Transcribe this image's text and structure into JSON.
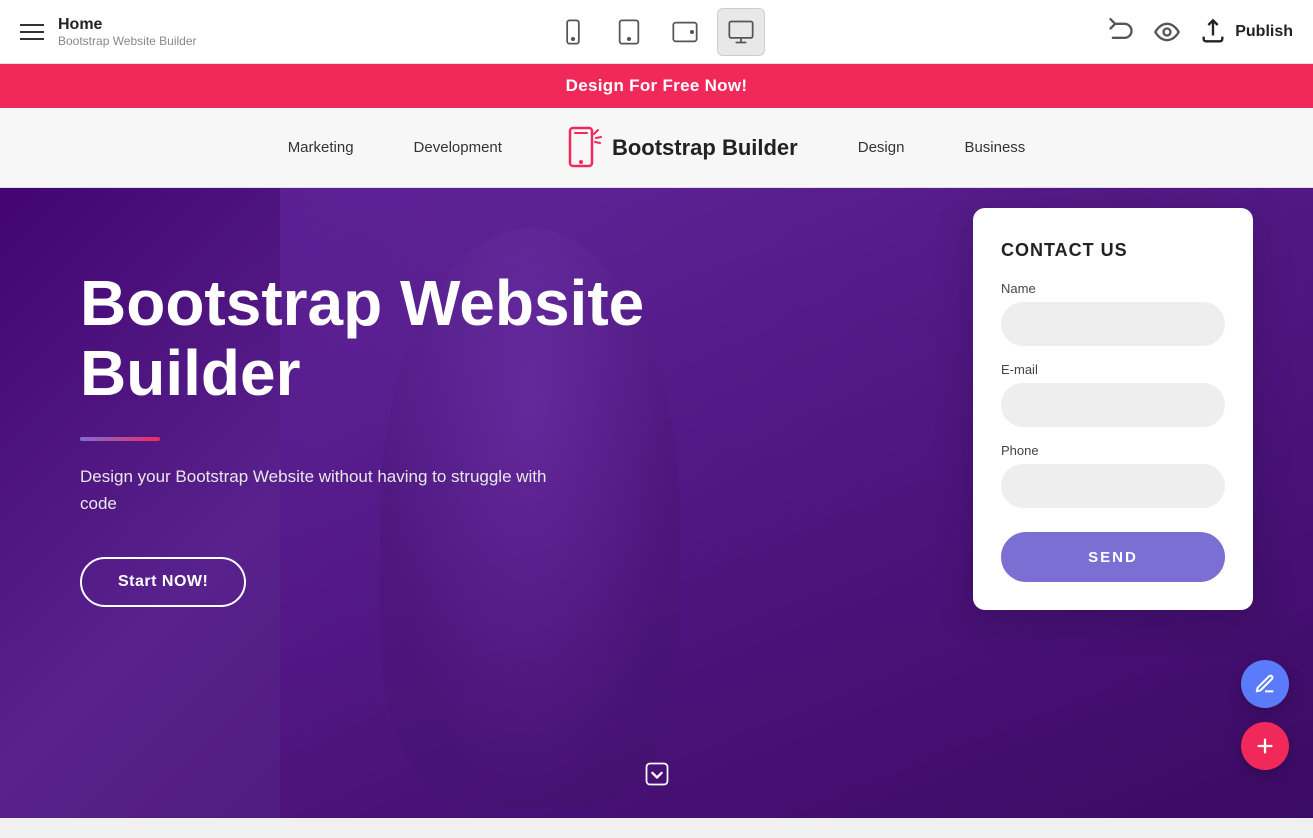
{
  "toolbar": {
    "home_label": "Home",
    "subtitle": "Bootstrap Website Builder",
    "publish_label": "Publish"
  },
  "promo": {
    "text": "Design For Free Now!"
  },
  "site_nav": {
    "links": [
      "Marketing",
      "Development",
      "Design",
      "Business"
    ],
    "brand_name": "Bootstrap Builder"
  },
  "hero": {
    "title": "Bootstrap Website Builder",
    "subtitle": "Design your Bootstrap Website without having to struggle with code",
    "cta_label": "Start NOW!"
  },
  "contact": {
    "title": "CONTACT US",
    "name_label": "Name",
    "email_label": "E-mail",
    "phone_label": "Phone",
    "send_label": "SEND",
    "name_placeholder": "",
    "email_placeholder": "",
    "phone_placeholder": ""
  },
  "devices": {
    "mobile_label": "mobile",
    "tablet_label": "tablet",
    "tablet_landscape_label": "tablet-landscape",
    "desktop_label": "desktop"
  }
}
